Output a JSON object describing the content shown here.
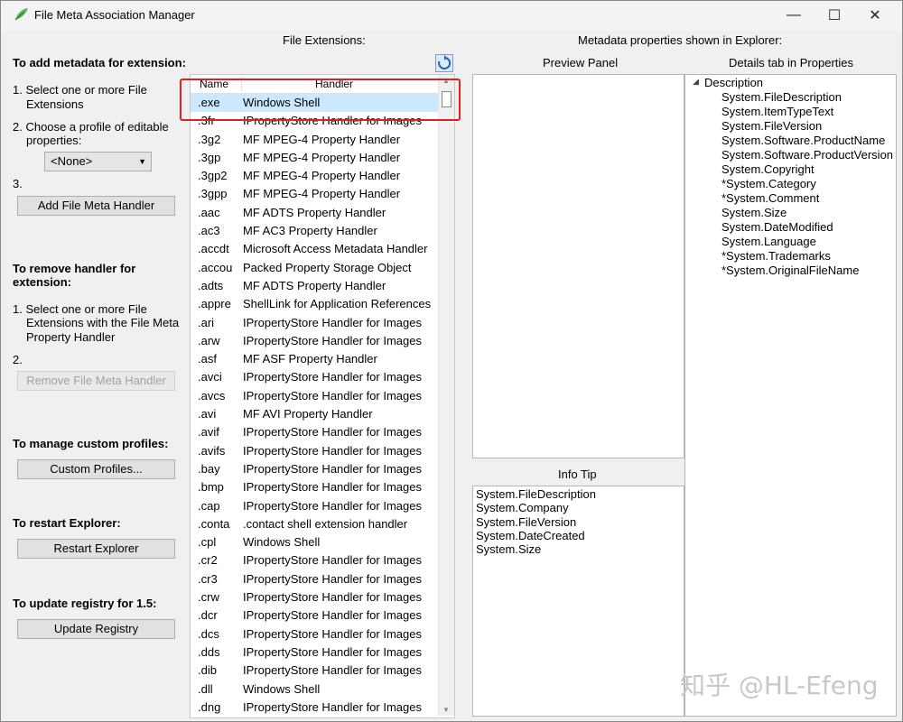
{
  "window": {
    "title": "File Meta Association Manager",
    "minimize": "—",
    "maximize": "☐",
    "close": "✕"
  },
  "left": {
    "add_heading": "To add metadata for extension:",
    "add_step1": "1. Select one or more File",
    "add_step1b": "Extensions",
    "add_step2": "2. Choose a profile of editable",
    "add_step2b": "properties:",
    "profile_value": "<None>",
    "add_step3": "3.",
    "add_button": "Add File Meta Handler",
    "remove_heading1": "To remove handler for",
    "remove_heading2": "extension:",
    "remove_step1a": "1. Select one or more File",
    "remove_step1b": "Extensions with the File Meta",
    "remove_step1c": "Property Handler",
    "remove_step2": "2.",
    "remove_button": "Remove File Meta Handler",
    "profiles_heading": "To manage custom profiles:",
    "profiles_button": "Custom Profiles...",
    "restart_heading": "To restart Explorer:",
    "restart_button": "Restart Explorer",
    "registry_heading": "To update registry for 1.5:",
    "registry_button": "Update Registry"
  },
  "extensions": {
    "label": "File Extensions:",
    "col_name": "Name",
    "col_handler": "Handler",
    "rows": [
      {
        "ext": ".exe",
        "handler": "Windows Shell"
      },
      {
        "ext": ".3fr",
        "handler": "IPropertyStore Handler for Images"
      },
      {
        "ext": ".3g2",
        "handler": "MF MPEG-4 Property Handler"
      },
      {
        "ext": ".3gp",
        "handler": "MF MPEG-4 Property Handler"
      },
      {
        "ext": ".3gp2",
        "handler": "MF MPEG-4 Property Handler"
      },
      {
        "ext": ".3gpp",
        "handler": "MF MPEG-4 Property Handler"
      },
      {
        "ext": ".aac",
        "handler": "MF ADTS Property Handler"
      },
      {
        "ext": ".ac3",
        "handler": "MF AC3 Property Handler"
      },
      {
        "ext": ".accdt",
        "handler": "Microsoft Access Metadata Handler"
      },
      {
        "ext": ".accou",
        "handler": "Packed Property Storage Object"
      },
      {
        "ext": ".adts",
        "handler": "MF ADTS Property Handler"
      },
      {
        "ext": ".appre",
        "handler": "ShellLink for Application References"
      },
      {
        "ext": ".ari",
        "handler": "IPropertyStore Handler for Images"
      },
      {
        "ext": ".arw",
        "handler": "IPropertyStore Handler for Images"
      },
      {
        "ext": ".asf",
        "handler": "MF ASF Property Handler"
      },
      {
        "ext": ".avci",
        "handler": "IPropertyStore Handler for Images"
      },
      {
        "ext": ".avcs",
        "handler": "IPropertyStore Handler for Images"
      },
      {
        "ext": ".avi",
        "handler": "MF AVI Property Handler"
      },
      {
        "ext": ".avif",
        "handler": "IPropertyStore Handler for Images"
      },
      {
        "ext": ".avifs",
        "handler": "IPropertyStore Handler for Images"
      },
      {
        "ext": ".bay",
        "handler": "IPropertyStore Handler for Images"
      },
      {
        "ext": ".bmp",
        "handler": "IPropertyStore Handler for Images"
      },
      {
        "ext": ".cap",
        "handler": "IPropertyStore Handler for Images"
      },
      {
        "ext": ".conta",
        "handler": ".contact shell extension handler"
      },
      {
        "ext": ".cpl",
        "handler": "Windows Shell"
      },
      {
        "ext": ".cr2",
        "handler": "IPropertyStore Handler for Images"
      },
      {
        "ext": ".cr3",
        "handler": "IPropertyStore Handler for Images"
      },
      {
        "ext": ".crw",
        "handler": "IPropertyStore Handler for Images"
      },
      {
        "ext": ".dcr",
        "handler": "IPropertyStore Handler for Images"
      },
      {
        "ext": ".dcs",
        "handler": "IPropertyStore Handler for Images"
      },
      {
        "ext": ".dds",
        "handler": "IPropertyStore Handler for Images"
      },
      {
        "ext": ".dib",
        "handler": "IPropertyStore Handler for Images"
      },
      {
        "ext": ".dll",
        "handler": "Windows Shell"
      },
      {
        "ext": ".dng",
        "handler": "IPropertyStore Handler for Images"
      }
    ]
  },
  "metadata": {
    "label": "Metadata properties shown in Explorer:",
    "preview_label": "Preview Panel",
    "details_label": "Details tab in Properties",
    "infotip_label": "Info Tip",
    "details_root": "Description",
    "details_items": [
      "System.FileDescription",
      "System.ItemTypeText",
      "System.FileVersion",
      "System.Software.ProductName",
      "System.Software.ProductVersion",
      "System.Copyright",
      "*System.Category",
      "*System.Comment",
      "System.Size",
      "System.DateModified",
      "System.Language",
      "*System.Trademarks",
      "*System.OriginalFileName"
    ],
    "infotip_items": [
      "System.FileDescription",
      "System.Company",
      "System.FileVersion",
      "System.DateCreated",
      "System.Size"
    ]
  },
  "watermark": "知乎 @HL-Efeng"
}
